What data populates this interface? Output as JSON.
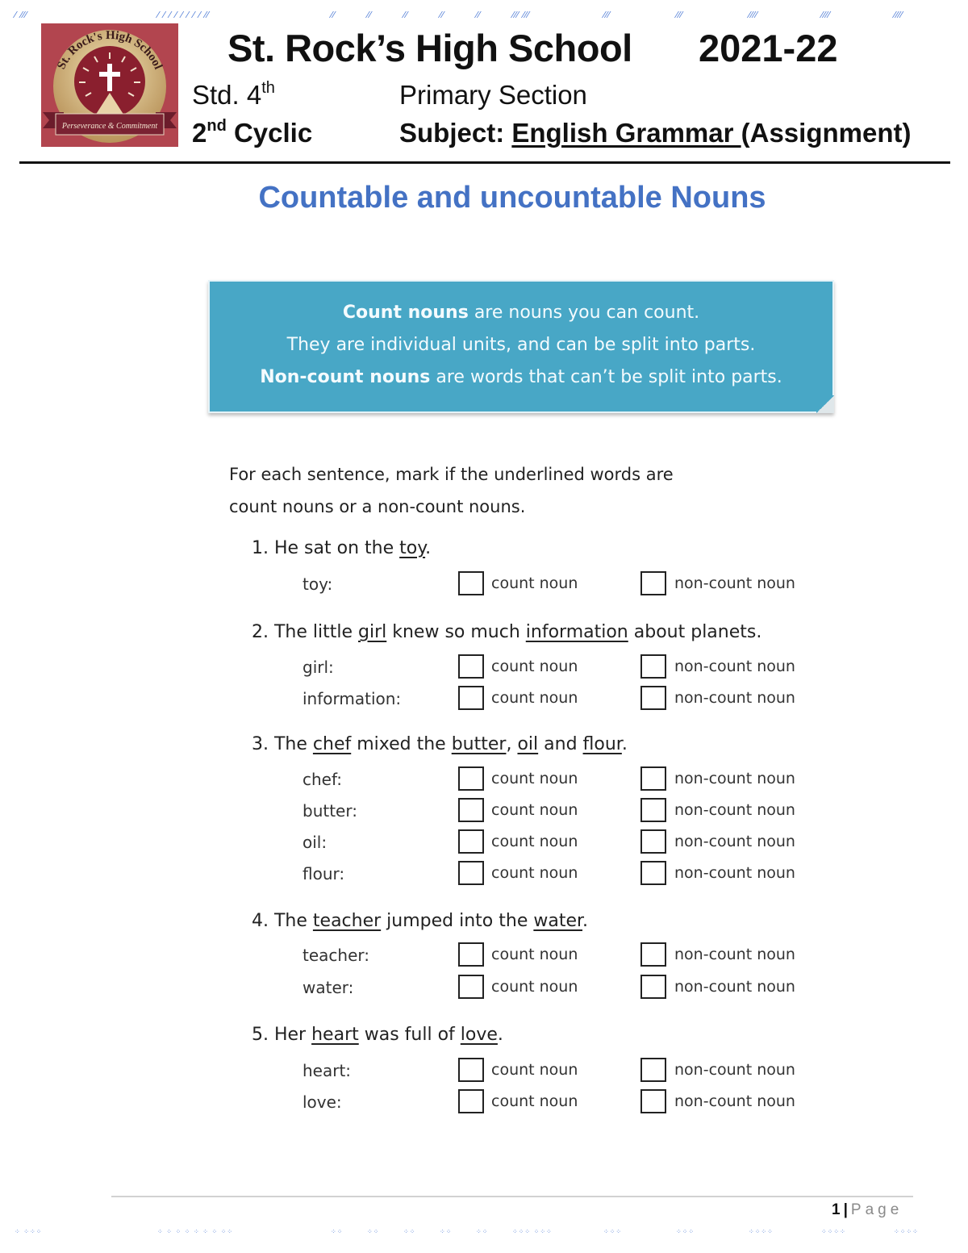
{
  "header": {
    "school_name": "St. Rock’s High School",
    "academic_year": "2021-22",
    "std_prefix": "Std. 4",
    "std_sup": "th",
    "section": "Primary Section",
    "cyclic_prefix": "2",
    "cyclic_sup": "nd",
    "cyclic_suffix": " Cyclic",
    "subject_label": "Subject: ",
    "subject_value": " English Grammar ",
    "subject_suffix": "(Assignment)",
    "logo": {
      "arc_text": "St. Rock's High School",
      "motto": "Perseverance & Commitment",
      "icon": "cross-icon"
    }
  },
  "page_heading": "Countable and uncountable Nouns",
  "definition_box": {
    "line1_bold": "Count nouns",
    "line1_rest": " are nouns you can count.",
    "line2": "They are individual units, and can be split into parts.",
    "line3_bold": "Non-count nouns",
    "line3_rest": " are words that can’t be split into parts."
  },
  "instructions": {
    "line1": "For each sentence, mark if the underlined words are",
    "line2": "count nouns or a non-count nouns."
  },
  "options": {
    "count": "count noun",
    "noncount": "non-count noun"
  },
  "questions": [
    {
      "parts": [
        {
          "t": "1. He sat on the "
        },
        {
          "t": "toy",
          "u": true
        },
        {
          "t": "."
        }
      ],
      "items": [
        "toy:"
      ]
    },
    {
      "parts": [
        {
          "t": "2. The little "
        },
        {
          "t": "girl",
          "u": true
        },
        {
          "t": " knew so much "
        },
        {
          "t": "information",
          "u": true
        },
        {
          "t": " about planets."
        }
      ],
      "items": [
        "girl:",
        "information:"
      ]
    },
    {
      "parts": [
        {
          "t": "3. The "
        },
        {
          "t": "chef",
          "u": true
        },
        {
          "t": " mixed the "
        },
        {
          "t": "butter",
          "u": true
        },
        {
          "t": ", "
        },
        {
          "t": "oil",
          "u": true
        },
        {
          "t": " and "
        },
        {
          "t": "flour",
          "u": true
        },
        {
          "t": "."
        }
      ],
      "items": [
        "chef:",
        "butter:",
        "oil:",
        "flour:"
      ]
    },
    {
      "parts": [
        {
          "t": "4. The "
        },
        {
          "t": "teacher",
          "u": true
        },
        {
          "t": " jumped into the "
        },
        {
          "t": "water",
          "u": true
        },
        {
          "t": "."
        }
      ],
      "items": [
        "teacher:",
        "water:"
      ]
    },
    {
      "parts": [
        {
          "t": "5. Her "
        },
        {
          "t": "heart",
          "u": true
        },
        {
          "t": " was full of "
        },
        {
          "t": "love",
          "u": true
        },
        {
          "t": "."
        }
      ],
      "items": [
        "heart:",
        "love:"
      ]
    }
  ],
  "footer": {
    "page_number": "1",
    "separator": "|",
    "page_label": "Page"
  },
  "colors": {
    "heading": "#4472c4",
    "definition_box": "#48a7c6",
    "logo_bg": "#b2454f"
  }
}
